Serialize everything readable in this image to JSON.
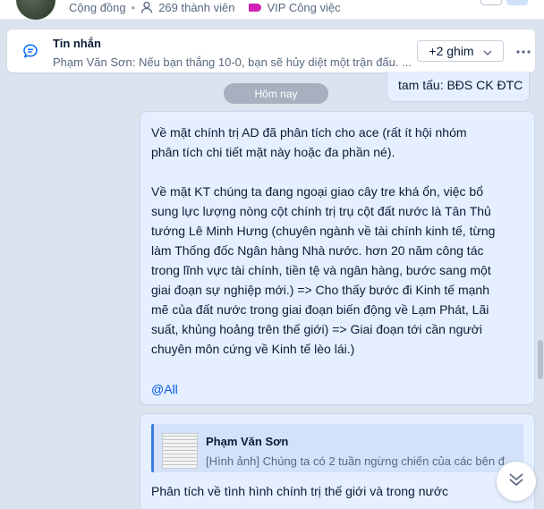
{
  "header": {
    "group_type": "Cộng đồng",
    "member_count": "269 thành viên",
    "tag_label": "VIP Công việc",
    "tag_color": "#d11fb2"
  },
  "pinned": {
    "title": "Tin nhắn",
    "preview": "Phạm Văn Sơn: Nếu bạn thắng 10-0, bạn sẽ hủy diệt một trận đấu. ...",
    "more_label": "+2 ghim",
    "menu_icon": "more-horizontal-icon"
  },
  "chat": {
    "previous_message_tail": "tam tấu: BĐS CK ĐTC",
    "date_separator": "Hôm nay",
    "message1": {
      "paragraph1": "Về mặt chính trị AD đã phân tích cho ace (rất ít hội nhóm\nphân tích chi tiết mặt này hoặc đa phần né).",
      "paragraph2": "Về mặt KT chúng ta đang ngoại giao cây tre khá ổn, việc bổ\nsung lực lượng nòng cột chính trị trụ cột đất nước là Tân Thủ\ntướng Lê Minh Hưng (chuyên ngành về tài chính kinh tế, từng\nlàm  Thống đốc Ngân hàng Nhà nước. hơn 20 năm công tác\ntrong lĩnh vực tài chính, tiền tệ và ngân hàng, bước sang một\ngiai đoạn sự nghiệp mới.) => Cho thấy bước đi Kinh tế mạnh\nmẽ của đất nước trong giai đoạn biến động về Lạm Phát, Lãi\nsuất, khủng hoảng trên thế giới) => Giai đoạn tới cần người\nchuyên môn cứng về Kinh tế lèo lái.)",
      "mention": "@All"
    },
    "message2": {
      "quote_author": "Phạm Văn Sơn",
      "quote_text": "[Hình ảnh] Chúng ta có 2 tuần ngừng chiến của các bên đ",
      "text": "Phân tích về tình hình chính trị thế giới và trong nước"
    }
  },
  "colors": {
    "bubble_bg": "#e5efff",
    "mention": "#005ae0",
    "date_pill": "#a6b0bf",
    "quote_accent": "#3e7be0"
  }
}
